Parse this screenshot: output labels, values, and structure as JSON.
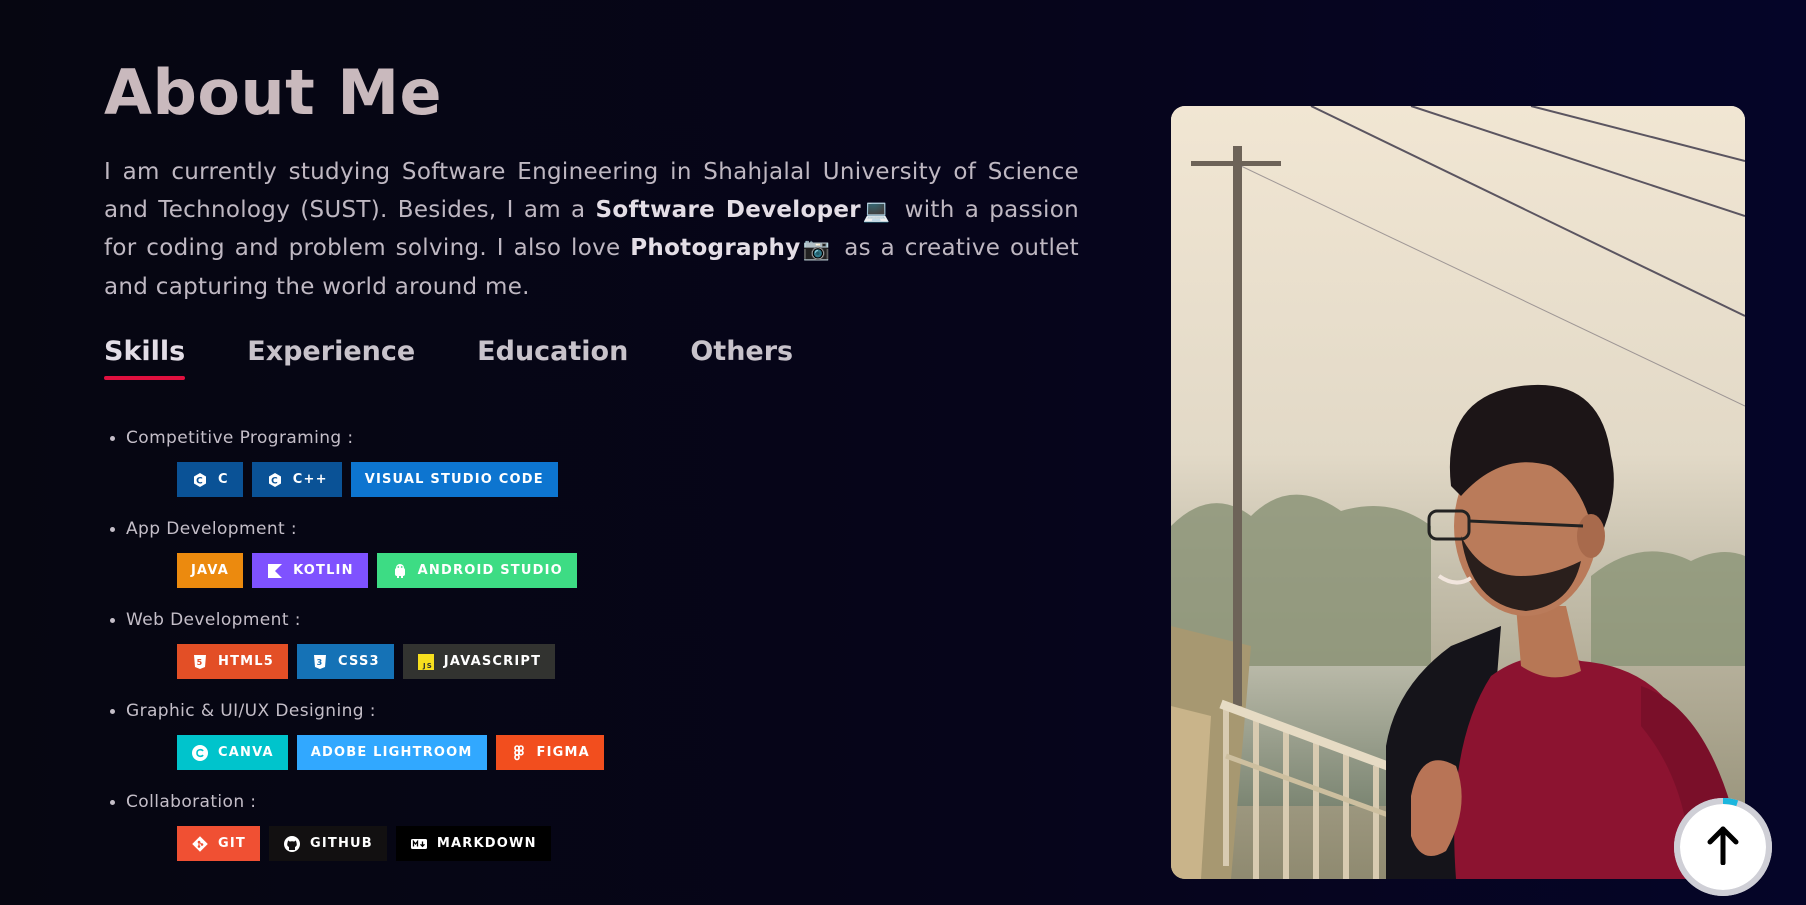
{
  "section": {
    "title": "About Me",
    "intro": {
      "part1": "I am currently studying Software Engineering in Shahjalal University of Science and Technology (SUST). Besides, I am a ",
      "bold1": "Software Developer",
      "emoji1": "💻",
      "part2": "with a passion for coding and problem solving. I also love ",
      "bold2": "Photography",
      "emoji2": "📷",
      "part3": "as a creative outlet and capturing the world around me."
    }
  },
  "tabs": [
    {
      "label": "Skills",
      "active": true
    },
    {
      "label": "Experience",
      "active": false
    },
    {
      "label": "Education",
      "active": false
    },
    {
      "label": "Others",
      "active": false
    }
  ],
  "skills": [
    {
      "title": "Competitive Programing :",
      "badges": [
        {
          "label": "C",
          "icon": "c-icon",
          "color": "#0a5296"
        },
        {
          "label": "C++",
          "icon": "cplusplus-icon",
          "color": "#0a5296"
        },
        {
          "label": "VISUAL STUDIO CODE",
          "icon": "",
          "color": "#0d75d0"
        }
      ]
    },
    {
      "title": "App Development :",
      "badges": [
        {
          "label": "JAVA",
          "icon": "",
          "color": "#ec8a0e"
        },
        {
          "label": "KOTLIN",
          "icon": "kotlin-icon",
          "color": "#7f52ff"
        },
        {
          "label": "ANDROID STUDIO",
          "icon": "android-icon",
          "color": "#3ddc84"
        }
      ]
    },
    {
      "title": "Web Development :",
      "badges": [
        {
          "label": "HTML5",
          "icon": "html5-icon",
          "color": "#e34f26"
        },
        {
          "label": "CSS3",
          "icon": "css3-icon",
          "color": "#1572b6"
        },
        {
          "label": "JAVASCRIPT",
          "icon": "javascript-icon",
          "color": "#323330"
        }
      ]
    },
    {
      "title": "Graphic & UI/UX Designing :",
      "badges": [
        {
          "label": "CANVA",
          "icon": "canva-icon",
          "color": "#00c4cc"
        },
        {
          "label": "ADOBE LIGHTROOM",
          "icon": "",
          "color": "#31a8ff"
        },
        {
          "label": "FIGMA",
          "icon": "figma-icon",
          "color": "#f24e1e"
        }
      ]
    },
    {
      "title": "Collaboration :",
      "badges": [
        {
          "label": "GIT",
          "icon": "git-icon",
          "color": "#f05033"
        },
        {
          "label": "GITHUB",
          "icon": "github-icon",
          "color": "#121011"
        },
        {
          "label": "MARKDOWN",
          "icon": "markdown-icon",
          "color": "#000000"
        }
      ]
    }
  ],
  "scroll_top": {
    "icon": "arrow-up-icon",
    "progress": 0.05
  }
}
